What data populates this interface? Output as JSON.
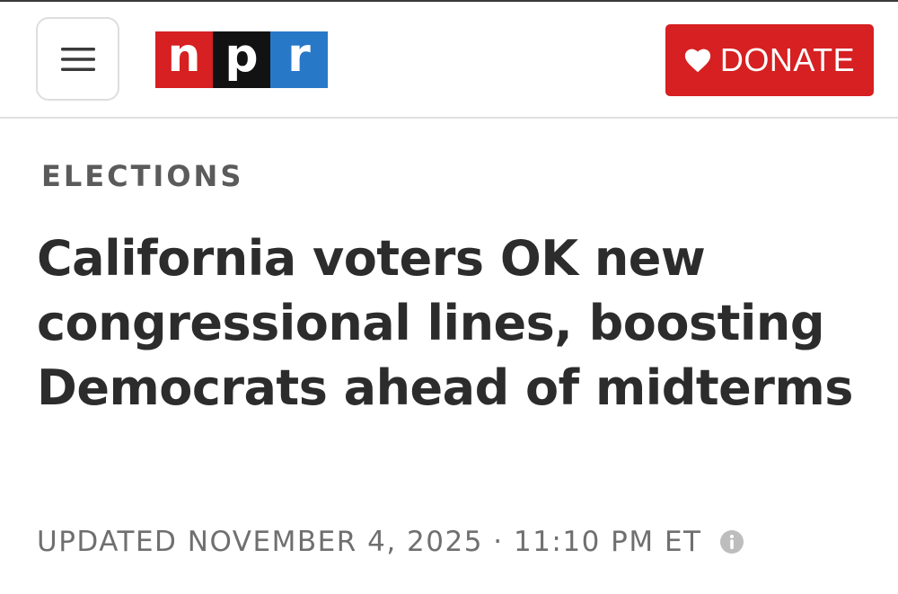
{
  "header": {
    "menu_icon": "hamburger-menu-icon",
    "logo": {
      "letters": [
        "n",
        "p",
        "r"
      ],
      "colors": [
        "#d62021",
        "#121212",
        "#2878c8"
      ]
    },
    "donate": {
      "icon": "heart-icon",
      "label": "DONATE",
      "color": "#d62021"
    }
  },
  "article": {
    "section": "ELECTIONS",
    "headline": "California voters OK new congressional lines, boosting Democrats ahead of midterms",
    "updated_label": "UPDATED NOVEMBER 4, 2025 · 11:10 PM ET",
    "info_icon": "info-icon"
  }
}
